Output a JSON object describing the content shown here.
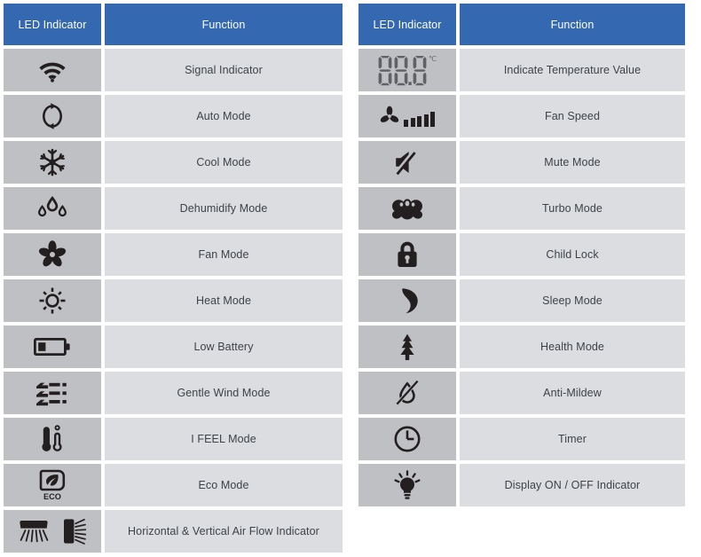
{
  "tables": [
    {
      "id": "left",
      "header": {
        "col1": "LED Indicator",
        "col2": "Function"
      },
      "rows": [
        {
          "icon": "wifi-signal-icon",
          "function": "Signal Indicator"
        },
        {
          "icon": "auto-mode-icon",
          "function": "Auto Mode"
        },
        {
          "icon": "snowflake-icon",
          "function": "Cool Mode"
        },
        {
          "icon": "water-drops-icon",
          "function": "Dehumidify Mode"
        },
        {
          "icon": "fan-blades-icon",
          "function": "Fan Mode"
        },
        {
          "icon": "sun-icon",
          "function": "Heat Mode"
        },
        {
          "icon": "low-battery-icon",
          "function": "Low Battery"
        },
        {
          "icon": "gentle-wind-icon",
          "function": "Gentle Wind Mode"
        },
        {
          "icon": "i-feel-thermometer-icon",
          "function": "I FEEL Mode"
        },
        {
          "icon": "eco-leaf-icon",
          "function": "Eco Mode"
        },
        {
          "icon": "airflow-icon",
          "function": "Horizontal & Vertical Air Flow Indicator"
        }
      ]
    },
    {
      "id": "right",
      "header": {
        "col1": "LED Indicator",
        "col2": "Function"
      },
      "rows": [
        {
          "icon": "seven-segment-temp-icon",
          "function": "Indicate Temperature Value",
          "display_value": "88.8",
          "display_unit": "℃"
        },
        {
          "icon": "fan-speed-icon",
          "function": "Fan Speed"
        },
        {
          "icon": "mute-speaker-icon",
          "function": "Mute Mode"
        },
        {
          "icon": "turbo-muscle-icon",
          "function": "Turbo Mode"
        },
        {
          "icon": "padlock-icon",
          "function": "Child Lock"
        },
        {
          "icon": "crescent-moon-icon",
          "function": "Sleep Mode"
        },
        {
          "icon": "pine-tree-icon",
          "function": "Health Mode"
        },
        {
          "icon": "anti-mildew-icon",
          "function": "Anti-Mildew"
        },
        {
          "icon": "clock-icon",
          "function": "Timer"
        },
        {
          "icon": "lightbulb-icon",
          "function": "Display ON / OFF Indicator"
        }
      ]
    }
  ],
  "colors": {
    "header_blue": "#3468b0",
    "icon_cell_gray": "#bfc0c3",
    "function_cell_gray": "#dcdde0",
    "icon_black": "#231f20",
    "text_dark": "#3d4349",
    "segment_gray": "#5f6166",
    "page_background": "#ffffff"
  }
}
